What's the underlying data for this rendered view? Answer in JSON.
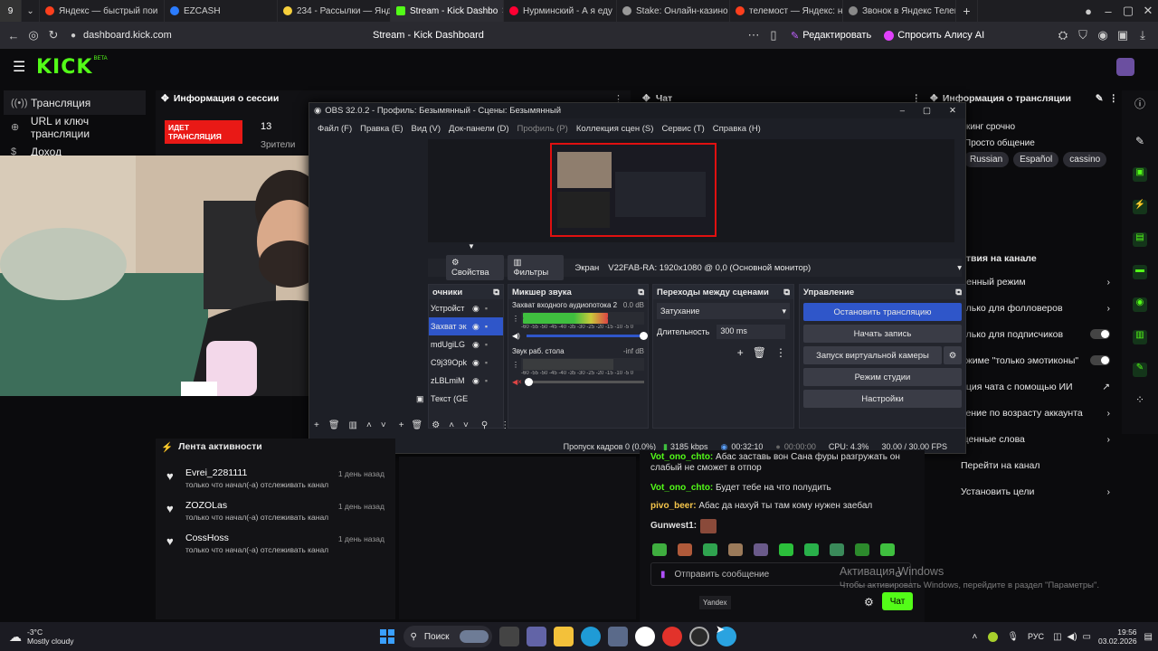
{
  "browser": {
    "tabs": [
      {
        "label": "9",
        "color": "#666"
      },
      {
        "label": "Яндекс — быстрый пои",
        "color": "#fc3f1d"
      },
      {
        "label": "EZCASH",
        "color": "#2b7cff"
      },
      {
        "label": "234 - Рассылки — Яндек",
        "color": "#f7d03c"
      },
      {
        "label": "Stream - Kick Dashbo",
        "color": "#53fc18"
      },
      {
        "label": "Нурминский - А я еду",
        "color": "#ff0033"
      },
      {
        "label": "Stake: Онлайн-казино и",
        "color": "#999"
      },
      {
        "label": "телемост — Яндекс: на",
        "color": "#fc3f1d"
      },
      {
        "label": "Звонок в Яндекс Телем",
        "color": "#888"
      }
    ],
    "url": "dashboard.kick.com",
    "page_title": "Stream - Kick Dashboard",
    "edit_label": "Редактировать",
    "alice_label": "Спросить Алису AI"
  },
  "kick": {
    "logo": "KICK",
    "logo_sup": "BETA"
  },
  "sidebar": {
    "items": [
      {
        "label": "Трансляция",
        "icon": "broadcast-icon"
      },
      {
        "label": "URL и ключ трансляции",
        "icon": "key-icon"
      },
      {
        "label": "Доход",
        "icon": "money-icon"
      }
    ]
  },
  "session": {
    "title": "Информация о сессии",
    "live_badge": "ИДЕТ ТРАНСЛЯЦИЯ",
    "viewers": "13",
    "viewers_label": "Зрители"
  },
  "chat_panel": {
    "title": "Чат"
  },
  "stream_info": {
    "title": "Информация о трансляции",
    "lines": [
      "кинг срочно",
      "Просто общение"
    ],
    "tags": [
      "Russian",
      "Español",
      "cassino"
    ]
  },
  "obs": {
    "title": "OBS 32.0.2 - Профиль: Безымянный - Сцены: Безымянный",
    "menu": [
      "Файл (F)",
      "Правка (E)",
      "Вид (V)",
      "Док-панели (D)",
      "Профиль (P)",
      "Коллекция сцен (S)",
      "Сервис (T)",
      "Справка (H)"
    ],
    "properties_label": "Свойства",
    "filters_label": "Фильтры",
    "screen_label": "Экран",
    "screen_value": "V22FAB-RA: 1920x1080 @ 0,0 (Основной монитор)",
    "sources_title": "очники",
    "sources": [
      "Устройст",
      "Захват эк",
      "mdUgiLG",
      "C9j39Opk",
      "zLBLmiM",
      "Текст (GE"
    ],
    "mixer_title": "Микшер звука",
    "mixer": [
      {
        "name": "Захват входного аудиопотока 2",
        "db": "0.0 dB",
        "level": 0.72
      },
      {
        "name": "Звук раб. стола",
        "db": "-inf dB",
        "level": 0.0
      }
    ],
    "meter_scale": "-60 -55 -50 -45 -40 -35 -30 -25 -20 -15 -10 -5 0",
    "transitions_title": "Переходы между сценами",
    "transition_value": "Затухание",
    "duration_label": "Длительность",
    "duration_value": "300 ms",
    "controls_title": "Управление",
    "controls": {
      "stop_stream": "Остановить трансляцию",
      "start_record": "Начать запись",
      "virtual_cam": "Запуск виртуальной камеры",
      "studio": "Режим студии",
      "settings": "Настройки"
    },
    "status": {
      "dropped": "Пропуск кадров 0 (0.0%)",
      "bitrate": "3185 kbps",
      "stream_time": "00:32:10",
      "rec_time": "00:00:00",
      "cpu": "CPU: 4.3%",
      "fps": "30.00 / 30.00 FPS"
    }
  },
  "activity": {
    "title": "Лента активности",
    "items": [
      {
        "user": "Evrei_2281111",
        "text": "только что начал(-а) отслеживать канал",
        "time": "1 день назад"
      },
      {
        "user": "ZOZOLas",
        "text": "только что начал(-а) отслеживать канал",
        "time": "1 день назад"
      },
      {
        "user": "CossHoss",
        "text": "только что начал(-а) отслеживать канал",
        "time": "1 день назад"
      }
    ]
  },
  "chat": {
    "messages": [
      {
        "user": "Vot_ono_chto:",
        "text": "Абас заставь вон Сана фуры разгружать он слабый не сможет в отпор"
      },
      {
        "user": "Vot_ono_chto:",
        "text": "Будет тебе на что полудить"
      },
      {
        "user": "pivo_beer:",
        "text": "Абас да нахуй ты там кому нужен заебал"
      },
      {
        "user": "Gunwest1:",
        "text": ""
      }
    ],
    "input_placeholder": "Отправить сообщение",
    "send_label": "Чат",
    "tooltip": "Yandex"
  },
  "right_settings": {
    "title": "ствия на канале",
    "rows": [
      {
        "label": "ленный режим",
        "control": "chevron"
      },
      {
        "label": "олько для фолловеров",
        "control": "chevron"
      },
      {
        "label": "олько для подписчиков",
        "control": "toggle"
      },
      {
        "label": "ежиме \"только эмотиконы\"",
        "control": "toggle"
      },
      {
        "label": "ация чата с помощью ИИ",
        "control": "external"
      },
      {
        "label": "чение по возрасту аккаунта",
        "control": "chevron"
      },
      {
        "label": "щенные слова",
        "control": "chevron"
      },
      {
        "label": "Перейти на канал",
        "control": "none"
      },
      {
        "label": "Установить цели",
        "control": "chevron"
      }
    ]
  },
  "watermark": {
    "title": "Активация Windows",
    "text": "Чтобы активировать Windows, перейдите в раздел \"Параметры\"."
  },
  "taskbar": {
    "weather_temp": "-3°C",
    "weather_text": "Mostly cloudy",
    "search": "Поиск",
    "lang": "РУС",
    "time": "19:56",
    "date": "03.02.2026"
  }
}
